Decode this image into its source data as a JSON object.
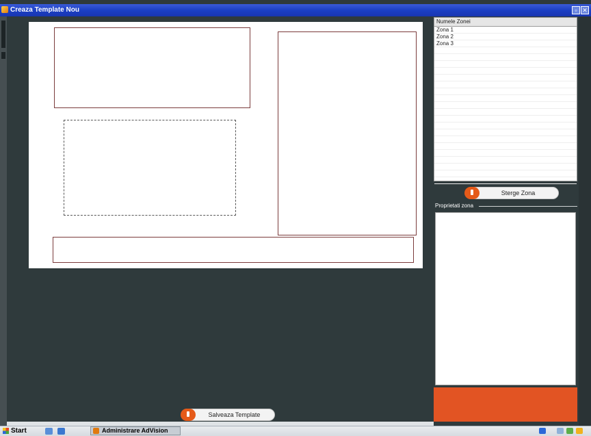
{
  "window": {
    "title": "Creaza Template Nou"
  },
  "zone_list": {
    "header": "Numele Zonei",
    "items": [
      "Zona 1",
      "Zona 2",
      "Zona 3"
    ]
  },
  "buttons": {
    "delete_zone": "Sterge Zona",
    "save_template": "Salveaza Template"
  },
  "properties": {
    "label": "Proprietati zona"
  },
  "taskbar": {
    "start": "Start",
    "active_item": "Administrare AdVision"
  },
  "colors": {
    "accent": "#e25423",
    "titlebar": "#1b3fc4",
    "workspace": "#2f3a3c"
  }
}
